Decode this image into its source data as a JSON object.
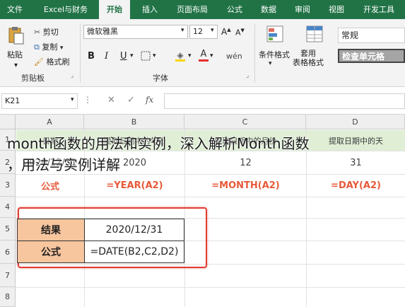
{
  "tabs": [
    "文件",
    "Excel与财务",
    "开始",
    "插入",
    "页面布局",
    "公式",
    "数据",
    "审阅",
    "视图",
    "开发工具"
  ],
  "ribbon": {
    "paste": "粘贴",
    "cut": "剪切",
    "copy": "复制",
    "format_painter": "格式刷",
    "clipboard_group": "剪贴板",
    "font_name": "微软雅黑",
    "font_size": "12",
    "font_group": "字体",
    "bold": "B",
    "italic": "I",
    "underline": "U",
    "font_color_glyph": "A",
    "conditional_format": "条件格式",
    "table_format": "套用\n表格格式",
    "number_format": "常规",
    "cell_style": "检查单元格"
  },
  "formula_bar": {
    "name_box": "K21",
    "fx": "fx",
    "content": ""
  },
  "columns": [
    "A",
    "B",
    "C",
    "D"
  ],
  "rows": [
    "1",
    "2",
    "3",
    "4",
    "5",
    "6",
    "7",
    "8"
  ],
  "row1": [
    "日期",
    "提取日期中的年份",
    "提取日期中的月份",
    "提取日期中的天"
  ],
  "row2": [
    "2020/12/31",
    "2020",
    "12",
    "31"
  ],
  "row3": [
    "公式",
    "=YEAR(A2)",
    "=MONTH(A2)",
    "=DAY(A2)"
  ],
  "box": {
    "label1": "结果",
    "value1": "2020/12/31",
    "label2": "公式",
    "value2": "=DATE(B2,C2,D2)",
    "border_color": "#e03c31"
  },
  "overlay_line1": "month函数的用法和实例，深入解析Month函数",
  "overlay_line2": "，用法与实例详解",
  "colors": {
    "tab_green": "#217346",
    "header_fill": "#dfeed5",
    "label_fill": "#f7c59e",
    "formula_text": "#e8593a"
  }
}
